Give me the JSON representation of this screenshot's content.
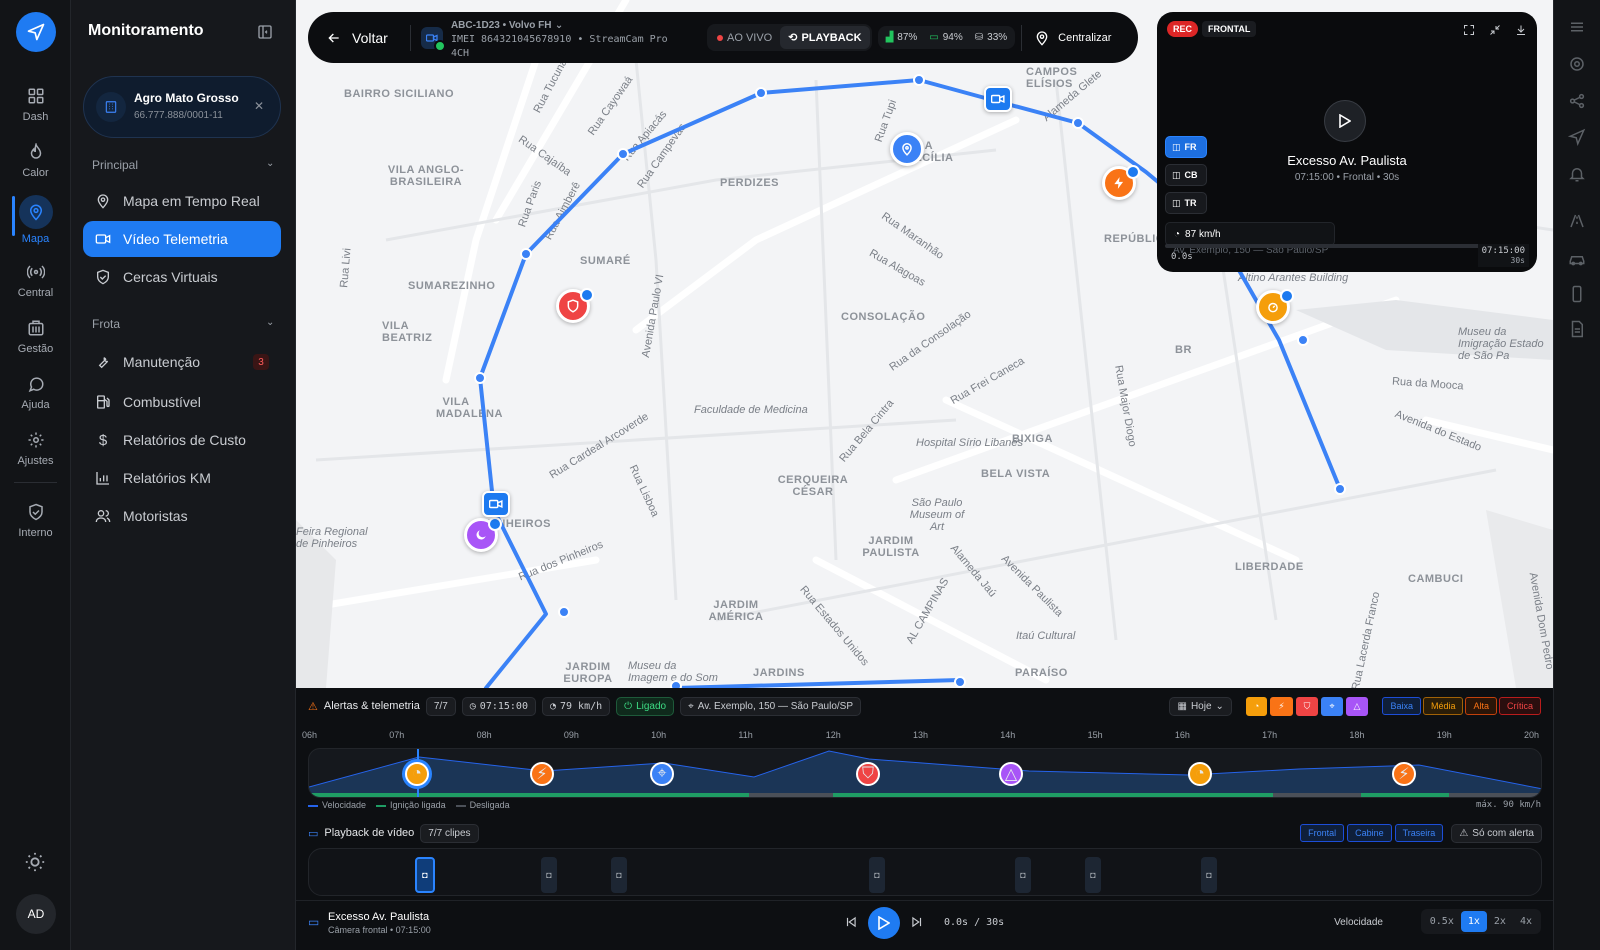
{
  "rail": {
    "items": [
      {
        "label": "Dash"
      },
      {
        "label": "Calor"
      },
      {
        "label": "Mapa"
      },
      {
        "label": "Central"
      },
      {
        "label": "Gestão"
      },
      {
        "label": "Ajuda"
      },
      {
        "label": "Ajustes"
      },
      {
        "label": "Interno"
      }
    ],
    "avatar": "AD"
  },
  "panel": {
    "title": "Monitoramento",
    "org": {
      "name": "Agro Mato Grosso",
      "cnpj": "66.777.888/0001-11"
    },
    "sections": [
      {
        "title": "Principal",
        "items": [
          {
            "label": "Mapa em Tempo Real",
            "icon": "pin-icon"
          },
          {
            "label": "Vídeo Telemetria",
            "icon": "video-icon",
            "active": true
          },
          {
            "label": "Cercas Virtuais",
            "icon": "shield-icon"
          }
        ]
      },
      {
        "title": "Frota",
        "items": [
          {
            "label": "Manutenção",
            "icon": "wrench-icon",
            "badge": "3"
          },
          {
            "label": "Combustível",
            "icon": "fuel-icon"
          },
          {
            "label": "Relatórios de Custo",
            "icon": "dollar-icon"
          },
          {
            "label": "Relatórios KM",
            "icon": "chart-icon"
          },
          {
            "label": "Motoristas",
            "icon": "users-icon"
          }
        ]
      }
    ]
  },
  "topbar": {
    "back": "Voltar",
    "vehicle": "ABC-1D23 • Volvo FH",
    "imei": "IMEI 864321045678910 • StreamCam Pro 4CH",
    "live": "AO VIVO",
    "playback": "PLAYBACK",
    "signal": "87%",
    "battery": "94%",
    "storage": "33%",
    "center": "Centralizar"
  },
  "map": {
    "districts": [
      {
        "t": "Bairro Siciliano"
      },
      {
        "t": "Vila Anglo-Brasileira"
      },
      {
        "t": "Perdizes"
      },
      {
        "t": "Sumaré"
      },
      {
        "t": "Sumarezinho"
      },
      {
        "t": "Vila Beatriz"
      },
      {
        "t": "Consolação"
      },
      {
        "t": "Vila Madalena"
      },
      {
        "t": "Pinheiros"
      },
      {
        "t": "Cerqueira César"
      },
      {
        "t": "Bela Vista"
      },
      {
        "t": "Bixiga"
      },
      {
        "t": "Jardim Paulista"
      },
      {
        "t": "Jardim América"
      },
      {
        "t": "Jardim Europa"
      },
      {
        "t": "Jardins"
      },
      {
        "t": "Paraíso"
      },
      {
        "t": "Liberdade"
      },
      {
        "t": "Cambuci"
      },
      {
        "t": "Campos Elísios"
      },
      {
        "t": "República"
      },
      {
        "t": "BR"
      },
      {
        "t": "Vila Cecília"
      }
    ],
    "streets": [
      "Rua Tucuna",
      "Rua Cayowaá",
      "Rua Apiacás",
      "Rua Cajaíba",
      "Rua Campevas",
      "Rua Paris",
      "Rua Aimberê",
      "Rua Tupi",
      "Alameda Glete",
      "Rua Maranhão",
      "Rua Alagoas",
      "Avenida Paulo VI",
      "Rua Livi",
      "Rua da Consolação",
      "Rua Frei Caneca",
      "Rua Bela Cintra",
      "Rua Major Diogo",
      "Faculdade de Medicina",
      "Hospital Sírio Libanês",
      "Rua Cardeal Arcoverde",
      "Rua Lisboa",
      "São Paulo Museum of Art",
      "Alameda Jaú",
      "Avenida Paulista",
      "Itaú Cultural",
      "Rua Estados Unidos",
      "AL CAMPINAS",
      "Rua dos Pinheiros",
      "Museu da Imagem e do Som",
      "Rua da Mooca",
      "Avenida do Estado",
      "Museu da Imigração Estado de São Pa",
      "Altino Arantes Building",
      "Avenida Dom Pedro",
      "Rua Lacerda Franco",
      "Feira Regional de Pinheiros"
    ]
  },
  "video": {
    "rec": "REC",
    "channel": "FRONTAL",
    "title": "Excesso Av. Paulista",
    "subtitle": "07:15:00 • Frontal • 30s",
    "channels": [
      "FR",
      "CB",
      "TR"
    ],
    "speed": "87 km/h",
    "address": "Av. Exemplo, 150 — São Paulo/SP",
    "t0": "0.0s",
    "t1": "07:15:00",
    "t1b": "30s",
    "progress": 0
  },
  "bottom": {
    "alerts_title": "Alertas & telemetria",
    "alerts_count": "7/7",
    "time": "07:15:00",
    "speed": "79 km/h",
    "ignition": "Ligado",
    "address": "Av. Exemplo, 150 — São Paulo/SP",
    "day": "Hoje",
    "severities": [
      "Baixa",
      "Média",
      "Alta",
      "Crítica"
    ],
    "hours": [
      "06h",
      "07h",
      "08h",
      "09h",
      "10h",
      "11h",
      "12h",
      "13h",
      "14h",
      "15h",
      "16h",
      "17h",
      "18h",
      "19h",
      "20h"
    ],
    "legend": [
      "Velocidade",
      "Ignição ligada",
      "Desligada"
    ],
    "max": "máx. 90 km/h",
    "playback_title": "Playback de vídeo",
    "clips_count": "7/7 clipes",
    "cams": [
      "Frontal",
      "Cabine",
      "Traseira"
    ],
    "only_alert": "Só com alerta",
    "now_title": "Excesso Av. Paulista",
    "now_sub": "Câmera frontal • 07:15:00",
    "pos": "0.0s / 30s",
    "speed_label": "Velocidade",
    "rates": [
      "0.5x",
      "1x",
      "2x",
      "4x"
    ]
  },
  "colors": {
    "accent": "#1f7bf2",
    "orange": "#f97316",
    "amber": "#f59e0b",
    "red": "#ef4444",
    "purple": "#a855f7",
    "blue": "#3b82f6",
    "green": "#22c55e"
  }
}
